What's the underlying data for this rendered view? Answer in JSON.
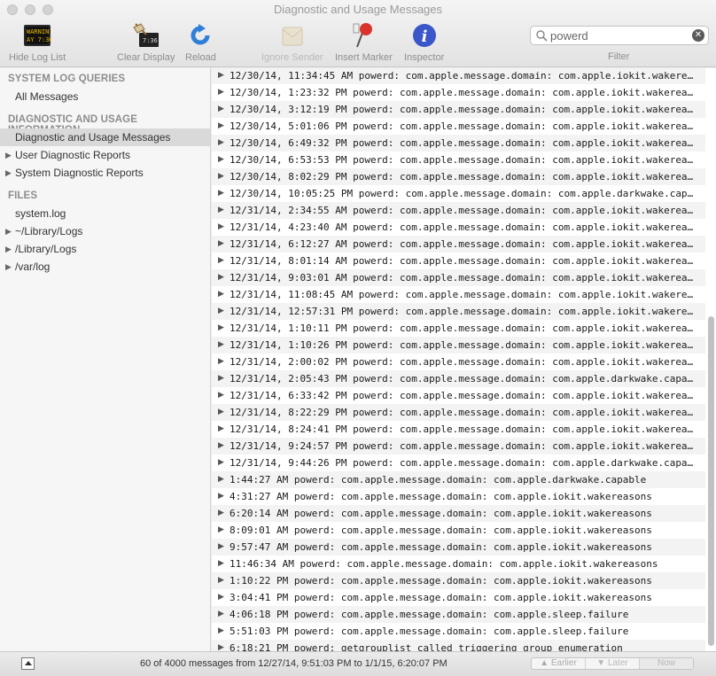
{
  "window": {
    "title": "Diagnostic and Usage Messages"
  },
  "toolbar": {
    "hide_log_list": "Hide Log List",
    "clear_display": "Clear Display",
    "reload": "Reload",
    "ignore_sender": "Ignore Sender",
    "insert_marker": "Insert Marker",
    "inspector": "Inspector",
    "log_icon_text": "WARNIN",
    "log_icon_text2": "AY 7:36",
    "clear_icon_text": "7:36"
  },
  "search": {
    "value": "powerd",
    "filter_label": "Filter"
  },
  "sidebar": {
    "sections": [
      {
        "title": "SYSTEM LOG QUERIES"
      },
      {
        "title": "DIAGNOSTIC AND USAGE INFORMATION"
      },
      {
        "title": "FILES"
      }
    ],
    "items": [
      {
        "label": "All Messages"
      },
      {
        "label": "Diagnostic and Usage Messages"
      },
      {
        "label": "User Diagnostic Reports"
      },
      {
        "label": "System Diagnostic Reports"
      },
      {
        "label": "system.log"
      },
      {
        "label": "~/Library/Logs"
      },
      {
        "label": "/Library/Logs"
      },
      {
        "label": "/var/log"
      }
    ]
  },
  "log_rows": [
    "12/30/14, 11:34:45 AM powerd: com.apple.message.domain: com.apple.iokit.wakerea…",
    "12/30/14, 1:23:32 PM powerd: com.apple.message.domain: com.apple.iokit.wakerea…",
    "12/30/14, 3:12:19 PM powerd: com.apple.message.domain: com.apple.iokit.wakerea…",
    "12/30/14, 5:01:06 PM powerd: com.apple.message.domain: com.apple.iokit.wakerea…",
    "12/30/14, 6:49:32 PM powerd: com.apple.message.domain: com.apple.iokit.wakerea…",
    "12/30/14, 6:53:53 PM powerd: com.apple.message.domain: com.apple.iokit.wakerea…",
    "12/30/14, 8:02:29 PM powerd: com.apple.message.domain: com.apple.iokit.wakerea…",
    "12/30/14, 10:05:25 PM powerd: com.apple.message.domain: com.apple.darkwake.capa…",
    "12/31/14, 2:34:55 AM powerd: com.apple.message.domain: com.apple.iokit.wakerea…",
    "12/31/14, 4:23:40 AM powerd: com.apple.message.domain: com.apple.iokit.wakerea…",
    "12/31/14, 6:12:27 AM powerd: com.apple.message.domain: com.apple.iokit.wakerea…",
    "12/31/14, 8:01:14 AM powerd: com.apple.message.domain: com.apple.iokit.wakerea…",
    "12/31/14, 9:03:01 AM powerd: com.apple.message.domain: com.apple.iokit.wakerea…",
    "12/31/14, 11:08:45 AM powerd: com.apple.message.domain: com.apple.iokit.wakere…",
    "12/31/14, 12:57:31 PM powerd: com.apple.message.domain: com.apple.iokit.wakere…",
    "12/31/14, 1:10:11 PM powerd: com.apple.message.domain: com.apple.iokit.wakerea…",
    "12/31/14, 1:10:26 PM powerd: com.apple.message.domain: com.apple.iokit.wakerea…",
    "12/31/14, 2:00:02 PM powerd: com.apple.message.domain: com.apple.iokit.wakerea…",
    "12/31/14, 2:05:43 PM powerd: com.apple.message.domain: com.apple.darkwake.capa…",
    "12/31/14, 6:33:42 PM powerd: com.apple.message.domain: com.apple.iokit.wakerea…",
    "12/31/14, 8:22:29 PM powerd: com.apple.message.domain: com.apple.iokit.wakerea…",
    "12/31/14, 8:24:41 PM powerd: com.apple.message.domain: com.apple.iokit.wakerea…",
    "12/31/14, 9:24:57 PM powerd: com.apple.message.domain: com.apple.iokit.wakerea…",
    "12/31/14, 9:44:26 PM powerd: com.apple.message.domain: com.apple.darkwake.capa…",
    "1:44:27 AM powerd: com.apple.message.domain: com.apple.darkwake.capable",
    "4:31:27 AM powerd: com.apple.message.domain: com.apple.iokit.wakereasons",
    "6:20:14 AM powerd: com.apple.message.domain: com.apple.iokit.wakereasons",
    "8:09:01 AM powerd: com.apple.message.domain: com.apple.iokit.wakereasons",
    "9:57:47 AM powerd: com.apple.message.domain: com.apple.iokit.wakereasons",
    "11:46:34 AM powerd: com.apple.message.domain: com.apple.iokit.wakereasons",
    "1:10:22 PM powerd: com.apple.message.domain: com.apple.iokit.wakereasons",
    "3:04:41 PM powerd: com.apple.message.domain: com.apple.iokit.wakereasons",
    "4:06:18 PM powerd: com.apple.message.domain: com.apple.sleep.failure",
    "5:51:03 PM powerd: com.apple.message.domain: com.apple.sleep.failure",
    "6:18:21 PM powerd: getgrouplist called triggering group enumeration"
  ],
  "status": {
    "summary": "60 of 4000 messages from 12/27/14, 9:51:03 PM to 1/1/15, 6:20:07 PM",
    "earlier": "Earlier",
    "later": "Later",
    "now": "Now"
  },
  "colors": {
    "selection": "#d9d9d9",
    "reload_blue": "#2f7fd8",
    "inspector_blue": "#3b56c9"
  }
}
